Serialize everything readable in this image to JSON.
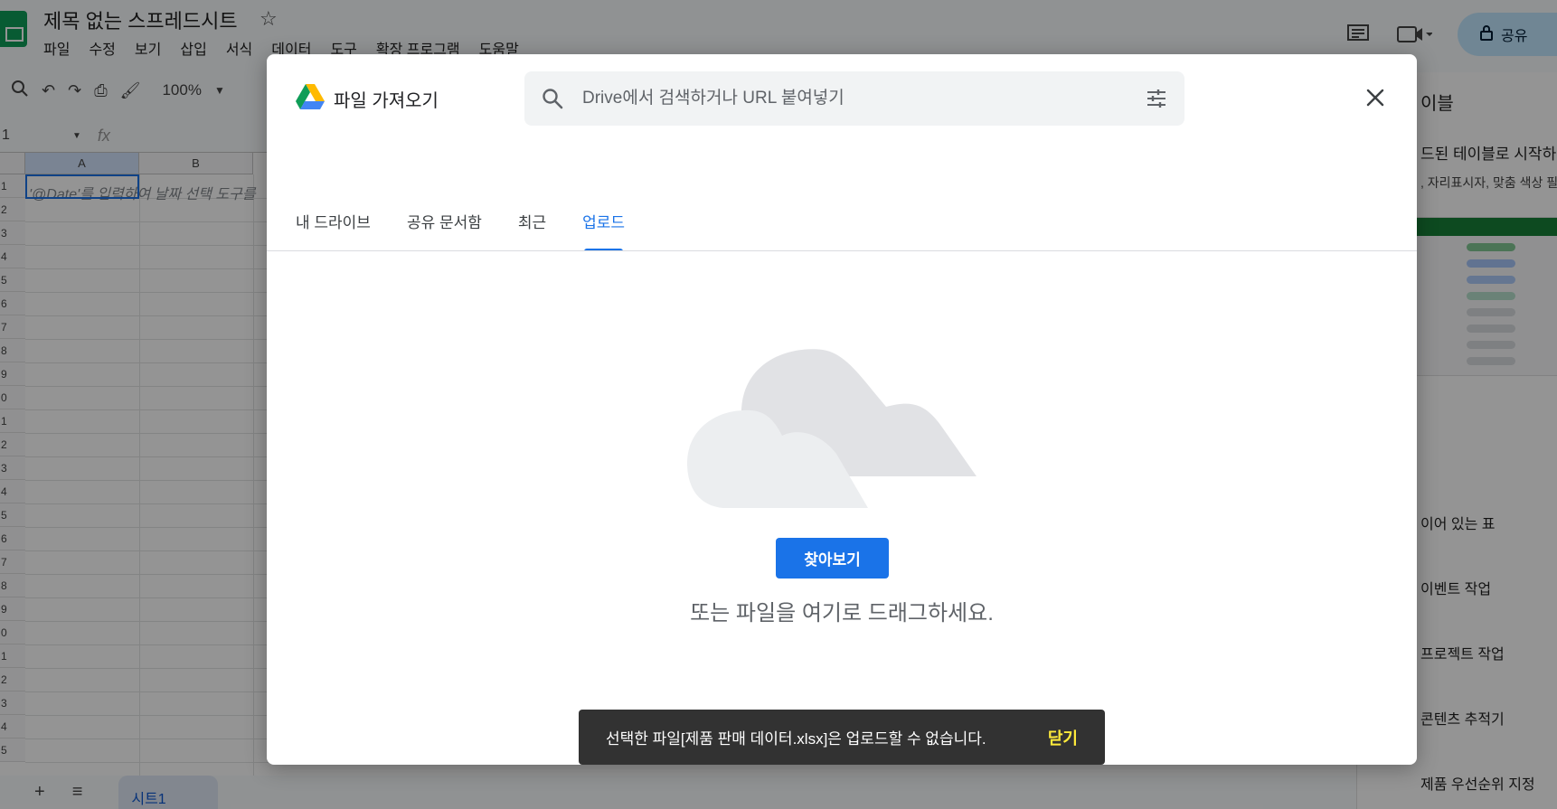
{
  "app": {
    "doc_title": "제목 없는 스프레드시트",
    "menu": [
      "파일",
      "수정",
      "보기",
      "삽입",
      "서식",
      "데이터",
      "도구",
      "확장 프로그램",
      "도움말"
    ],
    "share_label": "공유",
    "zoom": "100%",
    "cell_ref": "1",
    "formula_placeholder": "fx",
    "columns": [
      "A",
      "B"
    ],
    "rows": [
      "1",
      "2",
      "3",
      "4",
      "5",
      "6",
      "7",
      "8",
      "9",
      "0",
      "1",
      "2",
      "3",
      "4",
      "5",
      "6",
      "7",
      "8",
      "9",
      "0",
      "1",
      "2",
      "3",
      "4",
      "5"
    ],
    "cell_a1_hint": "'@Date'를 입력하여 날짜 선택 도구를",
    "sheet_tab": "시트1",
    "add_sheet": "+",
    "all_sheets": "≡"
  },
  "side_panel": {
    "title": "이블",
    "subtitle": "드된 테이블로 시작하",
    "desc": ", 자리표시자, 맞춤 색상 필",
    "items": [
      "이어 있는 표",
      "이벤트 작업",
      "프로젝트 작업",
      "콘텐츠 추적기",
      "제품 우선순위 지정"
    ]
  },
  "dialog": {
    "title": "파일 가져오기",
    "search_placeholder": "Drive에서 검색하거나 URL 붙여넣기",
    "tabs": [
      {
        "label": "내 드라이브",
        "active": false
      },
      {
        "label": "공유 문서함",
        "active": false
      },
      {
        "label": "최근",
        "active": false
      },
      {
        "label": "업로드",
        "active": true
      }
    ],
    "browse_label": "찾아보기",
    "drag_text": "또는 파일을 여기로 드래그하세요."
  },
  "snackbar": {
    "message": "선택한 파일[제품 판매 데이터.xlsx]은 업로드할 수 없습니다.",
    "action": "닫기"
  },
  "colors": {
    "accent": "#1a73e8",
    "snackbar_bg": "#323232",
    "snackbar_action": "#ffeb3b",
    "sheets_green": "#0f9d58"
  }
}
